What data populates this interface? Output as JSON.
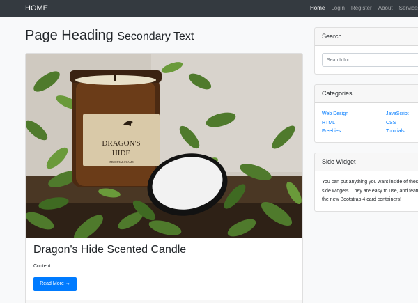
{
  "navbar": {
    "brand": "HOME",
    "links": [
      "Home",
      "Login",
      "Register",
      "About",
      "Services"
    ]
  },
  "page": {
    "heading": "Page Heading",
    "subheading": "Secondary Text"
  },
  "post": {
    "image": {
      "label_line1": "DRAGON'S",
      "label_line2": "HIDE",
      "label_line3": "IMMORTAL FLAME"
    },
    "title": "Dragon's Hide Scented Candle",
    "content": "Content",
    "read_more": "Read More →"
  },
  "search_widget": {
    "title": "Search",
    "placeholder": "Search for..."
  },
  "categories_widget": {
    "title": "Categories",
    "left": [
      "Web Design",
      "HTML",
      "Freebies"
    ],
    "right": [
      "JavaScript",
      "CSS",
      "Tutorials"
    ]
  },
  "side_widget": {
    "title": "Side Widget",
    "line1": "You can put anything you want inside of these",
    "line2": "side widgets. They are easy to use, and feature",
    "line3": "the new Bootstrap 4 card containers!"
  },
  "colors": {
    "navbar": "#343a40",
    "primary": "#007bff",
    "background": "#f8f9fa"
  }
}
